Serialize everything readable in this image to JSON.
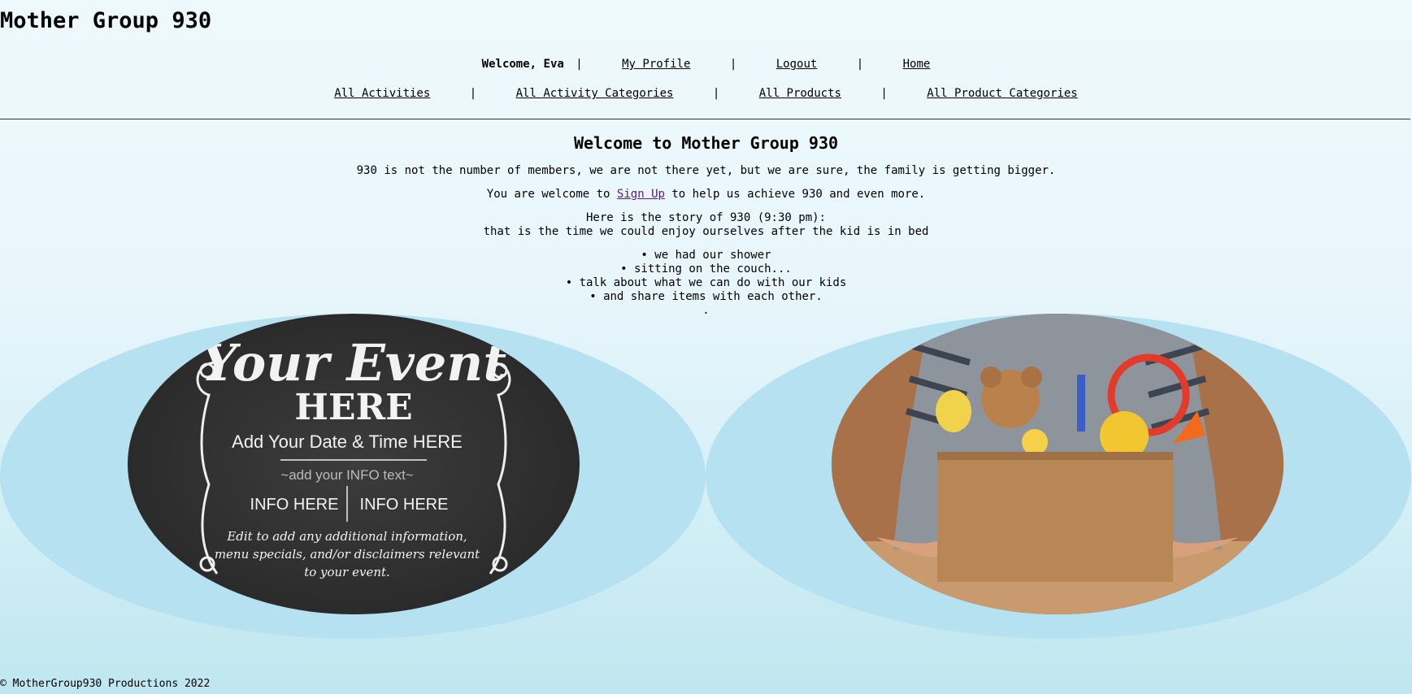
{
  "site": {
    "title": "Mother Group 930"
  },
  "nav": {
    "welcome": "Welcome, Eva",
    "sep": "|",
    "top_links": [
      {
        "label": "My Profile"
      },
      {
        "label": "Logout"
      },
      {
        "label": "Home"
      }
    ],
    "bottom_links": [
      {
        "label": "All Activities"
      },
      {
        "label": "All Activity Categories"
      },
      {
        "label": "All Products"
      },
      {
        "label": "All Product Categories"
      }
    ]
  },
  "main": {
    "heading": "Welcome to Mother Group 930",
    "intro": "930 is not the number of members, we are not there yet, but we are sure, the family is getting bigger.",
    "signup_prefix": "You are welcome to ",
    "signup_link": "Sign Up",
    "signup_suffix": " to help us achieve 930 and even more.",
    "story_line1": "Here is the story of 930 (9:30 pm):",
    "story_line2": "that is the time we could enjoy ourselves after the kid is in bed",
    "bullets": [
      "we had our shower",
      "sitting on the couch...",
      "talk about what we can do with our kids",
      "and share items with each other."
    ],
    "trailing_dot": "."
  },
  "event_image": {
    "line1": "Your Event",
    "line2": "HERE",
    "line3": "Add Your Date & Time HERE",
    "line4": "~add your INFO text~",
    "info_left": "INFO HERE",
    "info_right": "INFO HERE",
    "note1": "Edit to add any additional information,",
    "note2": "menu specials, and/or disclaimers relevant",
    "note3": "to your event."
  },
  "footer": {
    "text": "© MotherGroup930 Productions 2022"
  },
  "colors": {
    "banner": "#b5e1f1",
    "link_visited": "#551a8b",
    "chalkboard": "#2e2e2e"
  }
}
